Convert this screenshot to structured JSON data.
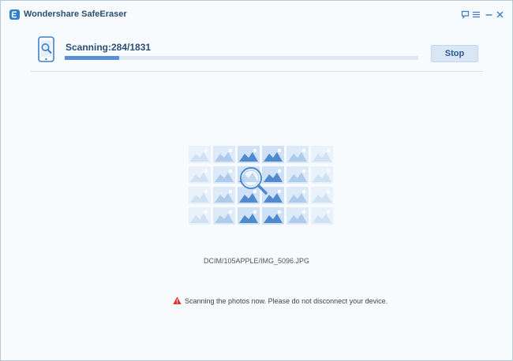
{
  "window": {
    "title": "Wondershare SafeEraser",
    "controls": [
      "feedback-icon",
      "menu-icon",
      "minimize-icon",
      "close-icon"
    ]
  },
  "scan": {
    "status": "Scanning:284/1831",
    "progress": 0.155,
    "stop_label": "Stop"
  },
  "current_file": "DCIM/105APPLE/IMG_5096.JPG",
  "warning": {
    "icon": "warning-triangle-icon",
    "text": "Scanning the photos now. Please do not disconnect your device."
  },
  "colors": {
    "accent": "#5b90d4",
    "title_text": "#2b4d6e",
    "warning": "#e0332f",
    "button_bg": "#d8e6f5"
  }
}
